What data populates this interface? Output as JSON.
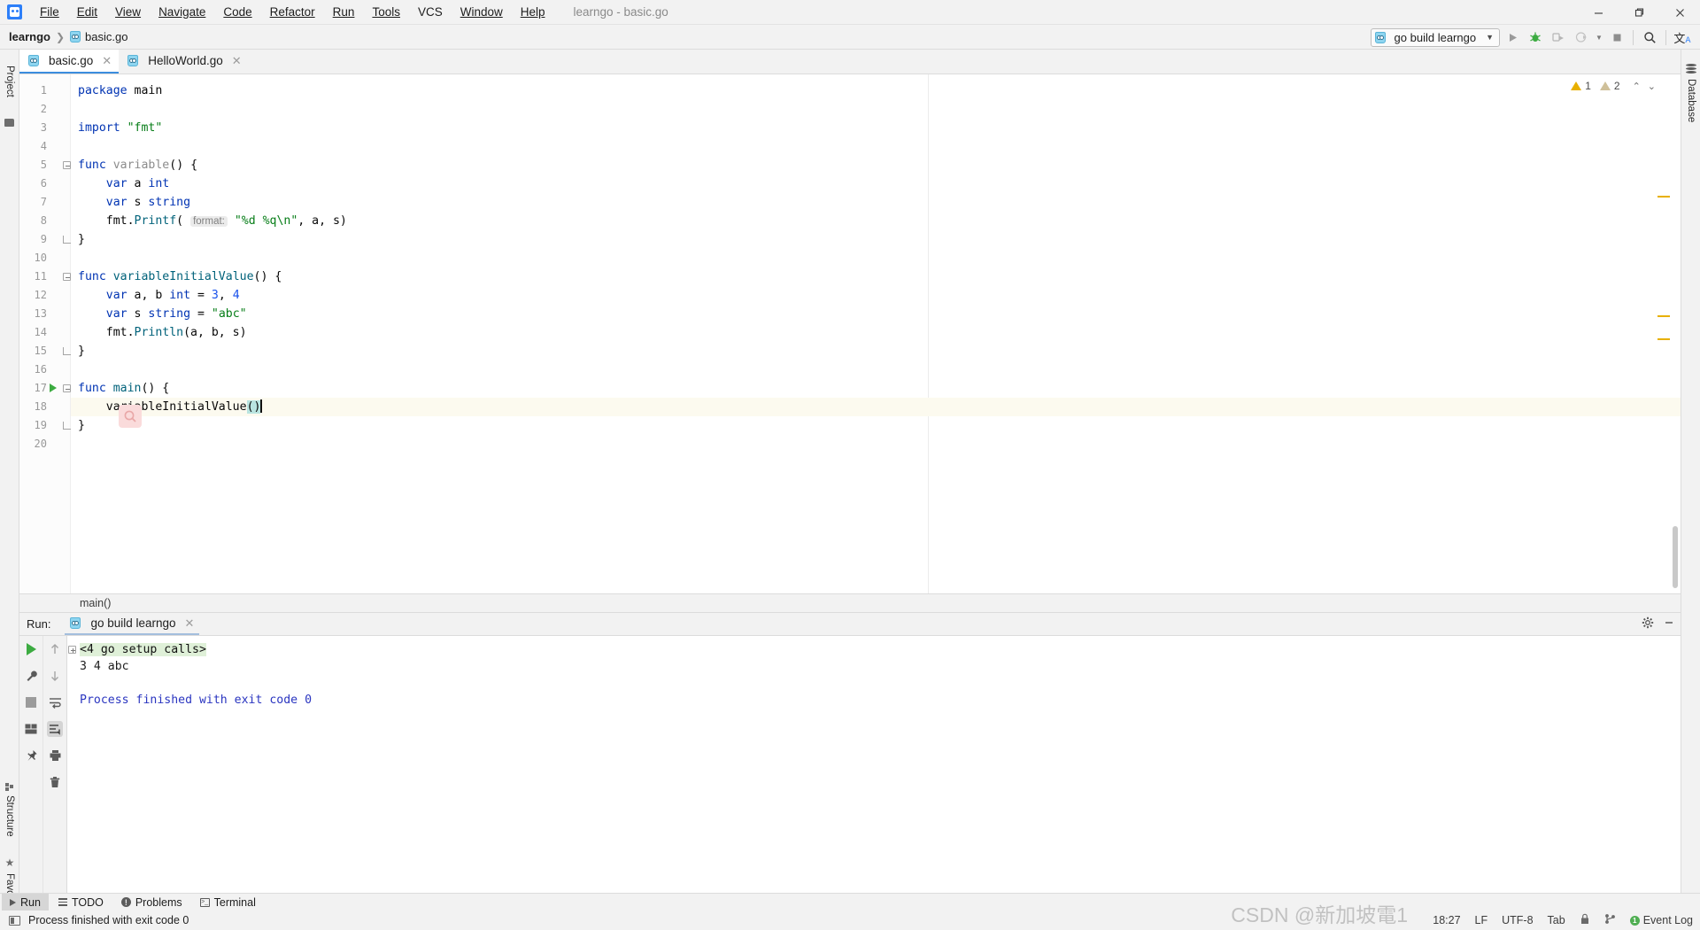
{
  "window": {
    "title": "learngo - basic.go",
    "logo_icon": "goland-logo-icon",
    "minimize": "—",
    "maximize": "❐",
    "close": "✕"
  },
  "menu": [
    {
      "label": "File"
    },
    {
      "label": "Edit"
    },
    {
      "label": "View"
    },
    {
      "label": "Navigate"
    },
    {
      "label": "Code"
    },
    {
      "label": "Refactor"
    },
    {
      "label": "Run"
    },
    {
      "label": "Tools"
    },
    {
      "label": "VCS"
    },
    {
      "label": "Window"
    },
    {
      "label": "Help"
    }
  ],
  "breadcrumb": {
    "project": "learngo",
    "separator": "❯",
    "file": "basic.go"
  },
  "toolbar": {
    "run_config": "go build learngo",
    "run_config_caret": "▼",
    "run_button": "▶",
    "debug_button": "bug-icon",
    "run_coverage_button": "run-with-coverage-icon",
    "profile_button": "profile-icon",
    "profile_caret": "▼",
    "stop_button": "■",
    "search_button": "search-icon",
    "translate_button": "translate-icon"
  },
  "left_tool_strip": [
    {
      "label": "Project",
      "icon": "project-icon"
    },
    {
      "label": "Structure",
      "icon": "structure-icon"
    },
    {
      "label": "Favorites",
      "icon": "favorites-star-icon"
    }
  ],
  "right_tool_strip": [
    {
      "label": "Database",
      "icon": "database-icon"
    }
  ],
  "editor": {
    "tabs": [
      {
        "label": "basic.go",
        "icon": "go-file-icon",
        "active": true,
        "close": "✕"
      },
      {
        "label": "HelloWorld.go",
        "icon": "go-file-icon",
        "active": false,
        "close": "✕"
      }
    ],
    "inspections": {
      "warning_count": "1",
      "weak_warning_count": "2",
      "prev": "⌃",
      "next": "⌄"
    },
    "breadcrumb_status": "main()",
    "caret_line": 18,
    "lines": [
      {
        "n": "1",
        "fold": "",
        "tokens": [
          {
            "t": "package",
            "c": "kw"
          },
          {
            "t": " main",
            "c": "plain"
          }
        ]
      },
      {
        "n": "2",
        "fold": "",
        "tokens": []
      },
      {
        "n": "3",
        "fold": "",
        "tokens": [
          {
            "t": "import",
            "c": "kw"
          },
          {
            "t": " ",
            "c": "plain"
          },
          {
            "t": "\"fmt\"",
            "c": "str"
          }
        ]
      },
      {
        "n": "4",
        "fold": "",
        "tokens": []
      },
      {
        "n": "5",
        "fold": "start",
        "tokens": [
          {
            "t": "func",
            "c": "kw"
          },
          {
            "t": " ",
            "c": "plain"
          },
          {
            "t": "variable",
            "c": "grey"
          },
          {
            "t": "() {",
            "c": "plain"
          }
        ]
      },
      {
        "n": "6",
        "fold": "",
        "tokens": [
          {
            "t": "    ",
            "c": "plain"
          },
          {
            "t": "var",
            "c": "kw"
          },
          {
            "t": " a ",
            "c": "plain"
          },
          {
            "t": "int",
            "c": "type"
          }
        ]
      },
      {
        "n": "7",
        "fold": "",
        "tokens": [
          {
            "t": "    ",
            "c": "plain"
          },
          {
            "t": "var",
            "c": "kw"
          },
          {
            "t": " s ",
            "c": "plain"
          },
          {
            "t": "string",
            "c": "type"
          }
        ]
      },
      {
        "n": "8",
        "fold": "",
        "tokens": [
          {
            "t": "    fmt.",
            "c": "plain"
          },
          {
            "t": "Printf",
            "c": "fn"
          },
          {
            "t": "( ",
            "c": "plain"
          },
          {
            "t": "format:",
            "c": "hint"
          },
          {
            "t": " ",
            "c": "plain"
          },
          {
            "t": "\"%d %q\\n\"",
            "c": "str"
          },
          {
            "t": ", a, s)",
            "c": "plain"
          }
        ]
      },
      {
        "n": "9",
        "fold": "end",
        "tokens": [
          {
            "t": "}",
            "c": "plain"
          }
        ]
      },
      {
        "n": "10",
        "fold": "",
        "tokens": []
      },
      {
        "n": "11",
        "fold": "start",
        "tokens": [
          {
            "t": "func",
            "c": "kw"
          },
          {
            "t": " ",
            "c": "plain"
          },
          {
            "t": "variableInitialValue",
            "c": "fn"
          },
          {
            "t": "() {",
            "c": "plain"
          }
        ]
      },
      {
        "n": "12",
        "fold": "",
        "tokens": [
          {
            "t": "    ",
            "c": "plain"
          },
          {
            "t": "var",
            "c": "kw"
          },
          {
            "t": " a, b ",
            "c": "plain"
          },
          {
            "t": "int",
            "c": "type"
          },
          {
            "t": " = ",
            "c": "plain"
          },
          {
            "t": "3",
            "c": "num"
          },
          {
            "t": ", ",
            "c": "plain"
          },
          {
            "t": "4",
            "c": "num"
          }
        ]
      },
      {
        "n": "13",
        "fold": "",
        "tokens": [
          {
            "t": "    ",
            "c": "plain"
          },
          {
            "t": "var",
            "c": "kw"
          },
          {
            "t": " s ",
            "c": "plain"
          },
          {
            "t": "string",
            "c": "type"
          },
          {
            "t": " = ",
            "c": "plain"
          },
          {
            "t": "\"abc\"",
            "c": "str"
          }
        ]
      },
      {
        "n": "14",
        "fold": "",
        "tokens": [
          {
            "t": "    fmt.",
            "c": "plain"
          },
          {
            "t": "Println",
            "c": "fn"
          },
          {
            "t": "(a, b, s)",
            "c": "plain"
          }
        ]
      },
      {
        "n": "15",
        "fold": "end",
        "tokens": [
          {
            "t": "}",
            "c": "plain"
          }
        ]
      },
      {
        "n": "16",
        "fold": "",
        "tokens": []
      },
      {
        "n": "17",
        "fold": "start",
        "run": true,
        "tokens": [
          {
            "t": "func",
            "c": "kw"
          },
          {
            "t": " ",
            "c": "plain"
          },
          {
            "t": "main",
            "c": "fn"
          },
          {
            "t": "() {",
            "c": "plain"
          }
        ]
      },
      {
        "n": "18",
        "fold": "",
        "caret": true,
        "tokens": [
          {
            "t": "    variableInitialValue",
            "c": "plain"
          },
          {
            "t": "()",
            "c": "sel"
          }
        ]
      },
      {
        "n": "19",
        "fold": "end",
        "tokens": [
          {
            "t": "}",
            "c": "plain"
          }
        ]
      },
      {
        "n": "20",
        "fold": "",
        "tokens": []
      }
    ],
    "overlay_badge_icon": "search-magnifier-icon"
  },
  "run_panel": {
    "label": "Run:",
    "tab": "go build learngo",
    "tab_icon": "go-run-config-icon",
    "tab_close": "✕",
    "settings_icon": "gear-icon",
    "minimize_icon": "minimize-icon",
    "toolbar_left": [
      {
        "icon": "rerun-play-icon"
      },
      {
        "icon": "wrench-settings-icon"
      },
      {
        "icon": "stop-icon"
      },
      {
        "icon": "layout-icon"
      },
      {
        "icon": "pin-icon"
      }
    ],
    "toolbar_right": [
      {
        "icon": "arrow-up-icon"
      },
      {
        "icon": "arrow-down-icon"
      },
      {
        "icon": "soft-wrap-icon"
      },
      {
        "icon": "scroll-to-end-icon"
      },
      {
        "icon": "print-icon"
      },
      {
        "icon": "trash-icon"
      }
    ],
    "console": [
      {
        "text": "<4 go setup calls>",
        "style": "setup",
        "fold": true
      },
      {
        "text": "3 4 abc",
        "style": "plain"
      },
      {
        "text": "",
        "style": "plain"
      },
      {
        "text": "Process finished with exit code 0",
        "style": "blue"
      }
    ]
  },
  "bottom_bar": [
    {
      "label": "Run",
      "icon": "run-icon",
      "active": true
    },
    {
      "label": "TODO",
      "icon": "todo-icon",
      "active": false
    },
    {
      "label": "Problems",
      "icon": "problems-icon",
      "active": false
    },
    {
      "label": "Terminal",
      "icon": "terminal-icon",
      "active": false
    }
  ],
  "status_bar": {
    "icon": "toggle-toolwindows-icon",
    "message": "Process finished with exit code 0",
    "time": "18:27",
    "line_separator": "LF",
    "encoding": "UTF-8",
    "indent": "Tab",
    "event_log": "Event Log",
    "event_log_badge": "1",
    "watermark": "CSDN @新加坡電1"
  }
}
